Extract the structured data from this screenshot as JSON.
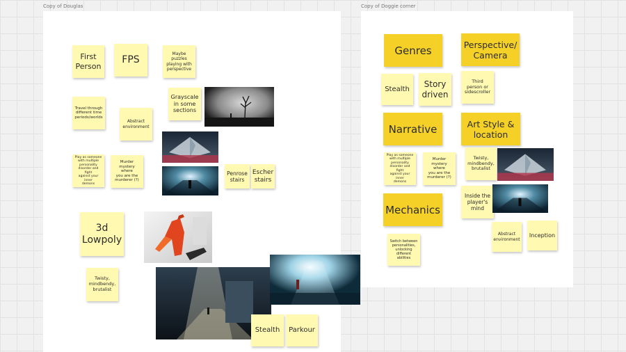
{
  "colors": {
    "canvas": "#f1f1f1",
    "frame": "#ffffff",
    "sticky_light": "#fff9b1",
    "sticky_dark": "#f5d128"
  },
  "frames": {
    "douglas": {
      "label": "Copy of Douglas"
    },
    "doggie": {
      "label": "Copy of Doggie corner"
    }
  },
  "douglas_notes": {
    "first_person": "First\nPerson",
    "fps": "FPS",
    "maybe_puzzles": "Maybe\npuzzles\nplaying with\nperspective",
    "grayscale": "Grayscale\nin some\nsections",
    "travel_time": "Travel through\ndifferent time\nperiods/worlds",
    "abstract_env": "Abstract\nenvironment",
    "play_as_someone": "Play as someone\nwith multiple\npersonality\ndisorder and fight\nagainst your inner\ndemons",
    "murder_mystery": "Murder\nmystery where\nyou are the\nmurderer (?)",
    "penrose": "Penrose\nstairs",
    "escher": "Escher\nstairs",
    "lowpoly": "3d\nLowpoly",
    "twisty": "Twisty,\nmindbendy,\nbrutalist",
    "stealth": "Stealth",
    "parkour": "Parkour"
  },
  "doggie_notes": {
    "genres": "Genres",
    "perspective_camera": "Perspective/\nCamera",
    "stealth": "Stealth",
    "story_driven": "Story\ndriven",
    "third_person": "Third\nperson or\nsidescroller",
    "narrative": "Narrative",
    "art_style": "Art Style &\nlocation",
    "play_as_someone": "Play as someone\nwith multiple\npersonality\ndisorder and fight\nagainst your inner\ndemons",
    "murder_mystery": "Murder\nmystery where\nyou are the\nmurderer (?)",
    "twisty": "Twisty,\nmindbendy,\nbrutalist",
    "mechanics": "Mechanics",
    "inside_mind": "Inside the\nplayer's\nmind",
    "switch_personalities": "Switch between\npersonalities,\nunlocking\ndifferent\nabilities",
    "abstract_env": "Abstract\nenvironment",
    "inception": "Inception"
  }
}
